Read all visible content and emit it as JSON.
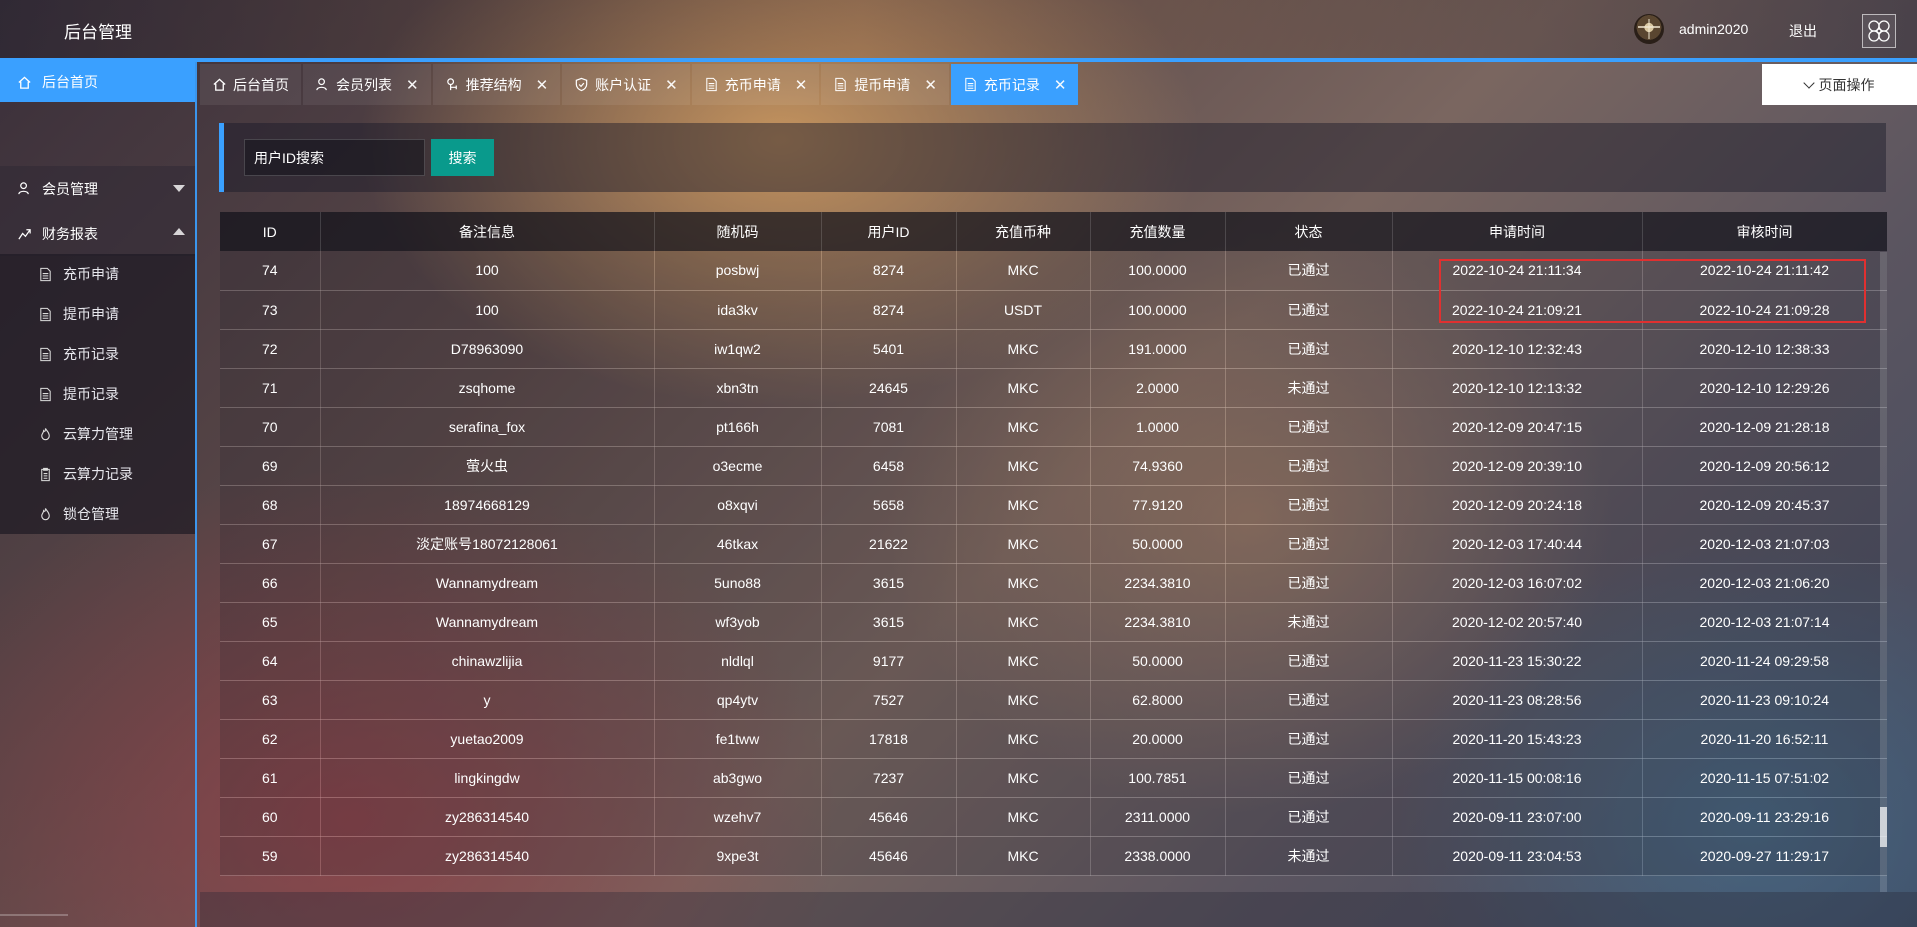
{
  "header": {
    "brand": "后台管理",
    "username": "admin2020",
    "logout": "退出"
  },
  "sidebar": {
    "home": "后台首页",
    "groups": [
      {
        "label": "会员管理",
        "icon": "user-icon"
      },
      {
        "label": "财务报表",
        "icon": "chart-icon"
      }
    ],
    "sub_items": [
      {
        "label": "充币申请",
        "icon": "document-icon"
      },
      {
        "label": "提币申请",
        "icon": "document-icon"
      },
      {
        "label": "充币记录",
        "icon": "document-icon"
      },
      {
        "label": "提币记录",
        "icon": "document-icon"
      },
      {
        "label": "云算力管理",
        "icon": "fire-icon"
      },
      {
        "label": "云算力记录",
        "icon": "clipboard-icon"
      },
      {
        "label": "锁仓管理",
        "icon": "fire-icon"
      }
    ]
  },
  "tabs": [
    {
      "label": "后台首页",
      "icon": "home-icon",
      "closable": false
    },
    {
      "label": "会员列表",
      "icon": "user-icon",
      "closable": true
    },
    {
      "label": "推荐结构",
      "icon": "tree-icon",
      "closable": true
    },
    {
      "label": "账户认证",
      "icon": "shield-icon",
      "closable": true
    },
    {
      "label": "充币申请",
      "icon": "document-icon",
      "closable": true
    },
    {
      "label": "提币申请",
      "icon": "document-icon",
      "closable": true
    },
    {
      "label": "充币记录",
      "icon": "document-icon",
      "closable": true,
      "active": true
    }
  ],
  "page_ops": "页面操作",
  "search": {
    "placeholder": "用户ID搜索",
    "button": "搜索"
  },
  "table": {
    "headers": [
      "ID",
      "备注信息",
      "随机码",
      "用户ID",
      "充值币种",
      "充值数量",
      "状态",
      "申请时间",
      "审核时间"
    ],
    "rows": [
      [
        "74",
        "100",
        "posbwj",
        "8274",
        "MKC",
        "100.0000",
        "已通过",
        "2022-10-24 21:11:34",
        "2022-10-24 21:11:42"
      ],
      [
        "73",
        "100",
        "ida3kv",
        "8274",
        "USDT",
        "100.0000",
        "已通过",
        "2022-10-24 21:09:21",
        "2022-10-24 21:09:28"
      ],
      [
        "72",
        "D78963090",
        "iw1qw2",
        "5401",
        "MKC",
        "191.0000",
        "已通过",
        "2020-12-10 12:32:43",
        "2020-12-10 12:38:33"
      ],
      [
        "71",
        "zsqhome",
        "xbn3tn",
        "24645",
        "MKC",
        "2.0000",
        "未通过",
        "2020-12-10 12:13:32",
        "2020-12-10 12:29:26"
      ],
      [
        "70",
        "serafina_fox",
        "pt166h",
        "7081",
        "MKC",
        "1.0000",
        "已通过",
        "2020-12-09 20:47:15",
        "2020-12-09 21:28:18"
      ],
      [
        "69",
        "萤火虫",
        "o3ecme",
        "6458",
        "MKC",
        "74.9360",
        "已通过",
        "2020-12-09 20:39:10",
        "2020-12-09 20:56:12"
      ],
      [
        "68",
        "18974668129",
        "o8xqvi",
        "5658",
        "MKC",
        "77.9120",
        "已通过",
        "2020-12-09 20:24:18",
        "2020-12-09 20:45:37"
      ],
      [
        "67",
        "淡定账号18072128061",
        "46tkax",
        "21622",
        "MKC",
        "50.0000",
        "已通过",
        "2020-12-03 17:40:44",
        "2020-12-03 21:07:03"
      ],
      [
        "66",
        "Wannamydream",
        "5uno88",
        "3615",
        "MKC",
        "2234.3810",
        "已通过",
        "2020-12-03 16:07:02",
        "2020-12-03 21:06:20"
      ],
      [
        "65",
        "Wannamydream",
        "wf3yob",
        "3615",
        "MKC",
        "2234.3810",
        "未通过",
        "2020-12-02 20:57:40",
        "2020-12-03 21:07:14"
      ],
      [
        "64",
        "chinawzlijia",
        "nldlql",
        "9177",
        "MKC",
        "50.0000",
        "已通过",
        "2020-11-23 15:30:22",
        "2020-11-24 09:29:58"
      ],
      [
        "63",
        "y",
        "qp4ytv",
        "7527",
        "MKC",
        "62.8000",
        "已通过",
        "2020-11-23 08:28:56",
        "2020-11-23 09:10:24"
      ],
      [
        "62",
        "yuetao2009",
        "fe1tww",
        "17818",
        "MKC",
        "20.0000",
        "已通过",
        "2020-11-20 15:43:23",
        "2020-11-20 16:52:11"
      ],
      [
        "61",
        "lingkingdw",
        "ab3gwo",
        "7237",
        "MKC",
        "100.7851",
        "已通过",
        "2020-11-15 00:08:16",
        "2020-11-15 07:51:02"
      ],
      [
        "60",
        "zy286314540",
        "wzehv7",
        "45646",
        "MKC",
        "2311.0000",
        "已通过",
        "2020-09-11 23:07:00",
        "2020-09-11 23:29:16"
      ],
      [
        "59",
        "zy286314540",
        "9xpe3t",
        "45646",
        "MKC",
        "2338.0000",
        "未通过",
        "2020-09-11 23:04:53",
        "2020-09-27 11:29:17"
      ]
    ]
  }
}
